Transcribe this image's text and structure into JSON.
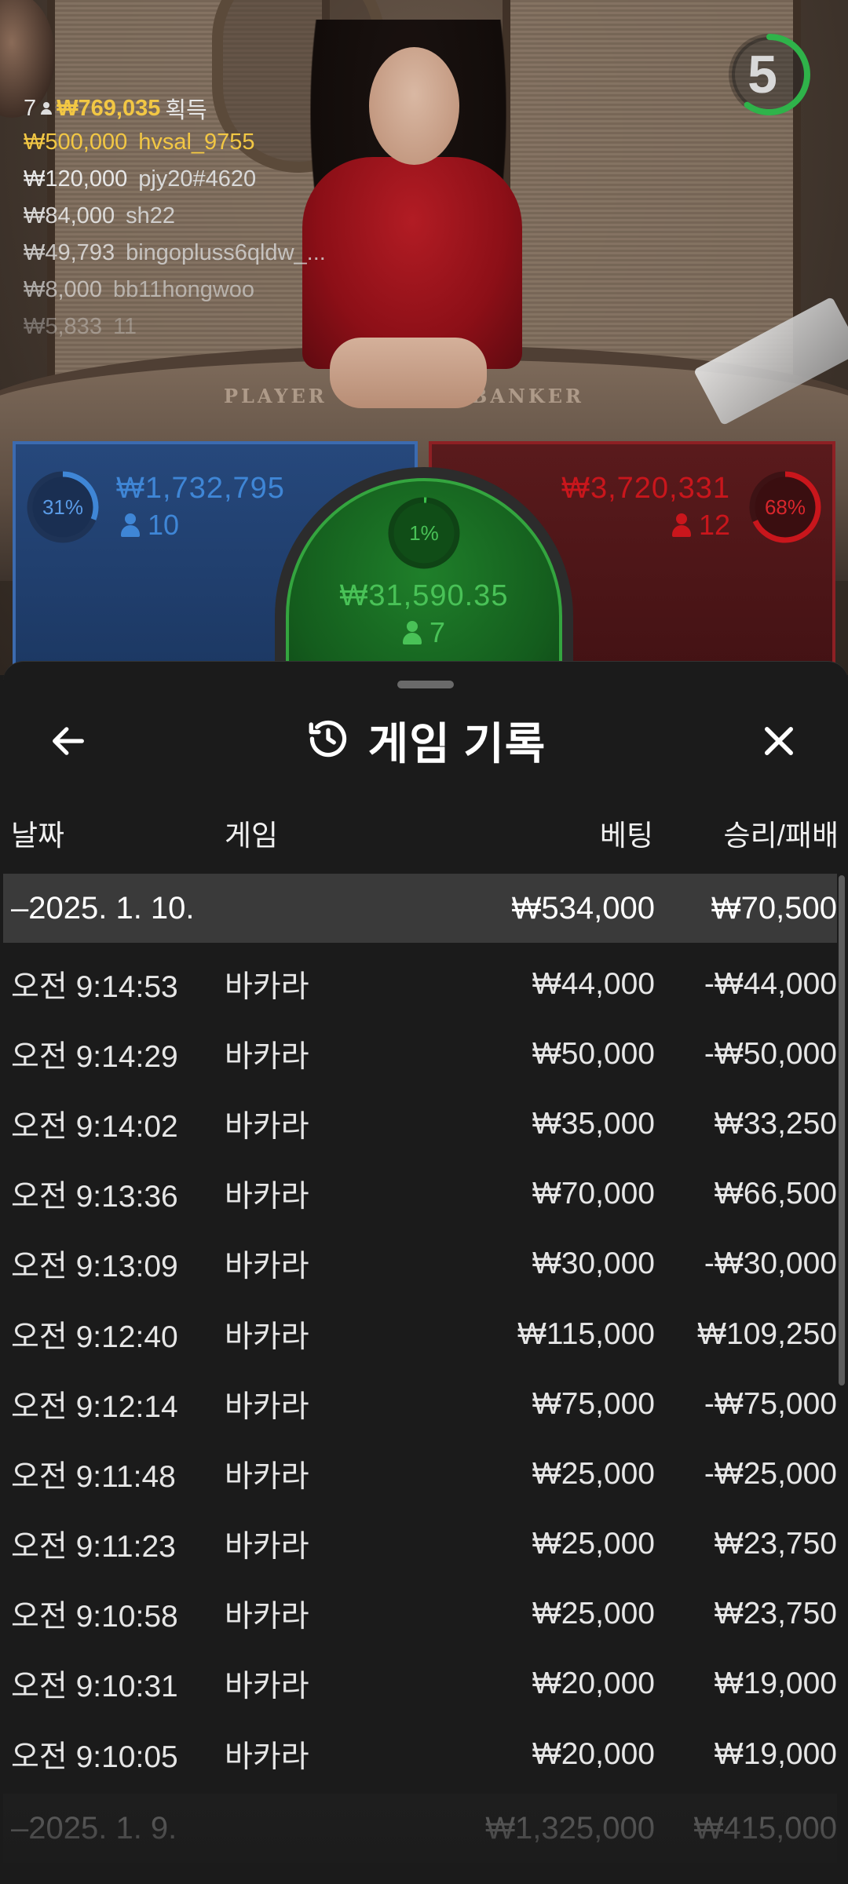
{
  "timer": {
    "value": "5",
    "progress": 0.6,
    "color": "#2fb34a"
  },
  "winners": {
    "count": "7",
    "total": "₩769,035",
    "suffix": "획득",
    "list": [
      {
        "amount": "₩500,000",
        "name": "hvsal_9755"
      },
      {
        "amount": "₩120,000",
        "name": "pjy20#4620"
      },
      {
        "amount": "₩84,000",
        "name": "sh22"
      },
      {
        "amount": "₩49,793",
        "name": "bingopluss6qldw_..."
      },
      {
        "amount": "₩8,000",
        "name": "bb11hongwoo"
      },
      {
        "amount": "₩5,833",
        "name": "11"
      }
    ]
  },
  "table_labels": {
    "player": "PLAYER",
    "banker": "BANKER"
  },
  "betting": {
    "player": {
      "percent": "31%",
      "percent_value": 0.31,
      "amount": "₩1,732,795",
      "players": "10",
      "color": "#3f86d6"
    },
    "banker": {
      "percent": "68%",
      "percent_value": 0.68,
      "amount": "₩3,720,331",
      "players": "12",
      "color": "#c9161c"
    },
    "tie": {
      "percent": "1%",
      "percent_value": 0.01,
      "amount": "₩31,590.35",
      "players": "7",
      "color": "#3bc24b"
    }
  },
  "history": {
    "title": "게임 기록",
    "columns": {
      "date": "날짜",
      "game": "게임",
      "bet": "베팅",
      "result": "승리/패배"
    },
    "groups": [
      {
        "date": "–2025. 1. 10.",
        "bet_total": "₩534,000",
        "result_total": "₩70,500",
        "rows": [
          {
            "time": "오전 9:14:53",
            "game": "바카라",
            "bet": "₩44,000",
            "result": "-₩44,000"
          },
          {
            "time": "오전 9:14:29",
            "game": "바카라",
            "bet": "₩50,000",
            "result": "-₩50,000"
          },
          {
            "time": "오전 9:14:02",
            "game": "바카라",
            "bet": "₩35,000",
            "result": "₩33,250"
          },
          {
            "time": "오전 9:13:36",
            "game": "바카라",
            "bet": "₩70,000",
            "result": "₩66,500"
          },
          {
            "time": "오전 9:13:09",
            "game": "바카라",
            "bet": "₩30,000",
            "result": "-₩30,000"
          },
          {
            "time": "오전 9:12:40",
            "game": "바카라",
            "bet": "₩115,000",
            "result": "₩109,250"
          },
          {
            "time": "오전 9:12:14",
            "game": "바카라",
            "bet": "₩75,000",
            "result": "-₩75,000"
          },
          {
            "time": "오전 9:11:48",
            "game": "바카라",
            "bet": "₩25,000",
            "result": "-₩25,000"
          },
          {
            "time": "오전 9:11:23",
            "game": "바카라",
            "bet": "₩25,000",
            "result": "₩23,750"
          },
          {
            "time": "오전 9:10:58",
            "game": "바카라",
            "bet": "₩25,000",
            "result": "₩23,750"
          },
          {
            "time": "오전 9:10:31",
            "game": "바카라",
            "bet": "₩20,000",
            "result": "₩19,000"
          },
          {
            "time": "오전 9:10:05",
            "game": "바카라",
            "bet": "₩20,000",
            "result": "₩19,000"
          }
        ]
      },
      {
        "date": "–2025. 1. 9.",
        "bet_total": "₩1,325,000",
        "result_total": "₩415,000",
        "rows": []
      }
    ]
  }
}
